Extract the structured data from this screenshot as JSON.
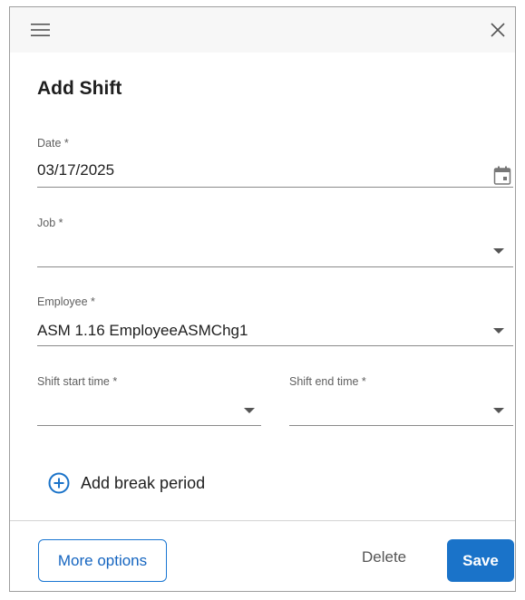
{
  "dialog": {
    "title": "Add Shift",
    "topbar": {
      "menu_icon": "hamburger-menu-icon",
      "close_icon": "close-icon"
    }
  },
  "form": {
    "date": {
      "label": "Date *",
      "value": "03/17/2025",
      "icon": "calendar-icon"
    },
    "job": {
      "label": "Job *",
      "value": ""
    },
    "employee": {
      "label": "Employee *",
      "value": "ASM 1.16 EmployeeASMChg1"
    },
    "shift_start": {
      "label": "Shift start time *",
      "value": ""
    },
    "shift_end": {
      "label": "Shift end time *",
      "value": ""
    },
    "add_break": {
      "label": "Add break period",
      "icon": "plus-circle-icon"
    }
  },
  "footer": {
    "more_options_label": "More options",
    "delete_label": "Delete",
    "save_label": "Save"
  },
  "colors": {
    "accent": "#1a73c9",
    "topbar_bg": "#f7f7f7"
  }
}
